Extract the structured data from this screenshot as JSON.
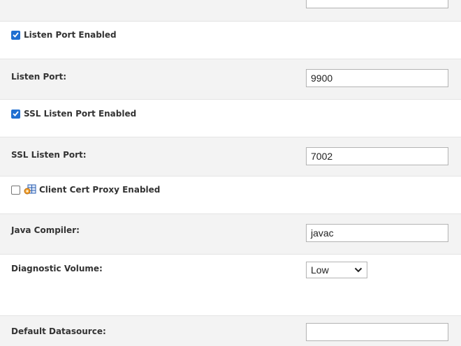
{
  "settings": {
    "listen_port_enabled": {
      "label": "Listen Port Enabled",
      "checked": true
    },
    "listen_port": {
      "label": "Listen Port:",
      "value": "9900"
    },
    "ssl_listen_port_enabled": {
      "label": "SSL Listen Port Enabled",
      "checked": true
    },
    "ssl_listen_port": {
      "label": "SSL Listen Port:",
      "value": "7002"
    },
    "client_cert_proxy_enabled": {
      "label": "Client Cert Proxy Enabled",
      "checked": false,
      "icon": "proxy-config-icon"
    },
    "java_compiler": {
      "label": "Java Compiler:",
      "value": "javac"
    },
    "diagnostic_volume": {
      "label": "Diagnostic Volume:",
      "selected": "Low"
    },
    "default_datasource": {
      "label": "Default Datasource:",
      "value": ""
    }
  },
  "colors": {
    "checkbox_checked": "#1f6fd1",
    "row_alt": "#f3f3f3",
    "border": "#b3b3b3"
  }
}
